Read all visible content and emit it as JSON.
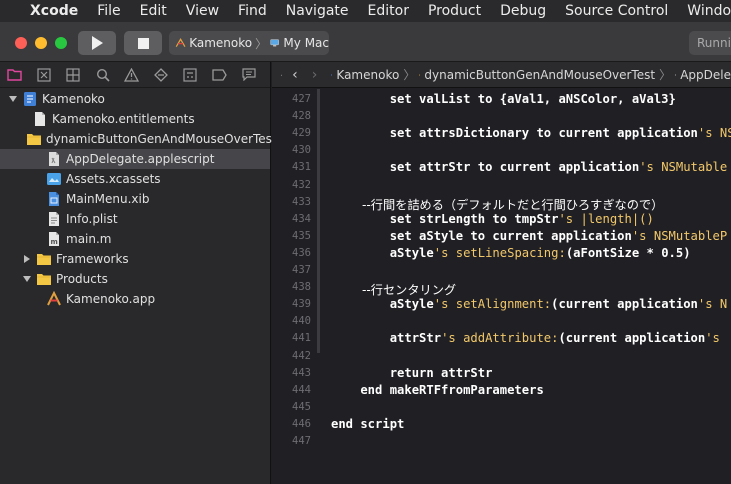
{
  "menubar": {
    "app_name": "Xcode",
    "items": [
      "File",
      "Edit",
      "View",
      "Find",
      "Navigate",
      "Editor",
      "Product",
      "Debug",
      "Source Control",
      "Window"
    ]
  },
  "toolbar": {
    "scheme_name": "Kamenoko",
    "destination": "My Mac",
    "status": "Running"
  },
  "navigator": {
    "tabs": [
      "project-navigator-icon",
      "source-control-icon",
      "symbol-navigator-icon",
      "find-navigator-icon",
      "issue-navigator-icon",
      "test-navigator-icon",
      "debug-navigator-icon",
      "breakpoint-navigator-icon",
      "report-navigator-icon"
    ],
    "items": [
      {
        "label": "Kamenoko",
        "icon": "project-icon",
        "level": 0,
        "expanded": true
      },
      {
        "label": "Kamenoko.entitlements",
        "icon": "file-icon",
        "level": 1
      },
      {
        "label": "dynamicButtonGenAndMouseOverTest",
        "icon": "folder-icon",
        "level": 1,
        "expanded": true
      },
      {
        "label": "AppDelegate.applescript",
        "icon": "applescript-file-icon",
        "level": 2,
        "selected": true
      },
      {
        "label": "Assets.xcassets",
        "icon": "asset-catalog-icon",
        "level": 2
      },
      {
        "label": "MainMenu.xib",
        "icon": "xib-file-icon",
        "level": 2
      },
      {
        "label": "Info.plist",
        "icon": "plist-file-icon",
        "level": 2
      },
      {
        "label": "main.m",
        "icon": "m-file-icon",
        "level": 2
      },
      {
        "label": "Frameworks",
        "icon": "folder-icon",
        "level": 1,
        "expanded": false
      },
      {
        "label": "Products",
        "icon": "folder-icon",
        "level": 1,
        "expanded": true
      },
      {
        "label": "Kamenoko.app",
        "icon": "app-icon",
        "level": 2
      }
    ]
  },
  "jumpbar": {
    "crumbs": [
      "Kamenoko",
      "dynamicButtonGenAndMouseOverTest",
      "AppDele"
    ]
  },
  "editor": {
    "line_numbers": [
      "427",
      "428",
      "429",
      "430",
      "431",
      "432",
      "433",
      "434",
      "435",
      "436",
      "437",
      "438",
      "439",
      "440",
      "441",
      "442",
      "443",
      "444",
      "445",
      "446",
      "447"
    ],
    "lines": [
      {
        "a": "        set valList to {aVal1, aNSColor, aVal3}"
      },
      {
        "a": ""
      },
      {
        "a": "        set attrsDictionary to current application",
        "b": "'s NS"
      },
      {
        "a": ""
      },
      {
        "a": "        set attrStr to current application",
        "b": "'s NSMutable"
      },
      {
        "a": ""
      },
      {
        "a": "        --行間を詰める（デフォルトだと行間ひろすぎなので）",
        "jp": true
      },
      {
        "a": "        set strLength to tmpStr",
        "b": "'s |length|()"
      },
      {
        "a": "        set aStyle to current application",
        "b": "'s NSMutableP"
      },
      {
        "a": "        aStyle",
        "b": "'s setLineSpacing:",
        "c": "(aFontSize * 0.5)"
      },
      {
        "a": ""
      },
      {
        "a": "        --行センタリング",
        "jp": true
      },
      {
        "a": "        aStyle",
        "b": "'s setAlignment:",
        "c": "(current application",
        "d": "'s N"
      },
      {
        "a": ""
      },
      {
        "a": "        attrStr",
        "b": "'s addAttribute:",
        "c": "(current application",
        "d": "'s "
      },
      {
        "a": ""
      },
      {
        "a": "        return attrStr"
      },
      {
        "a": "    end makeRTFfromParameters"
      },
      {
        "a": ""
      },
      {
        "a": "end script"
      },
      {
        "a": ""
      }
    ]
  }
}
